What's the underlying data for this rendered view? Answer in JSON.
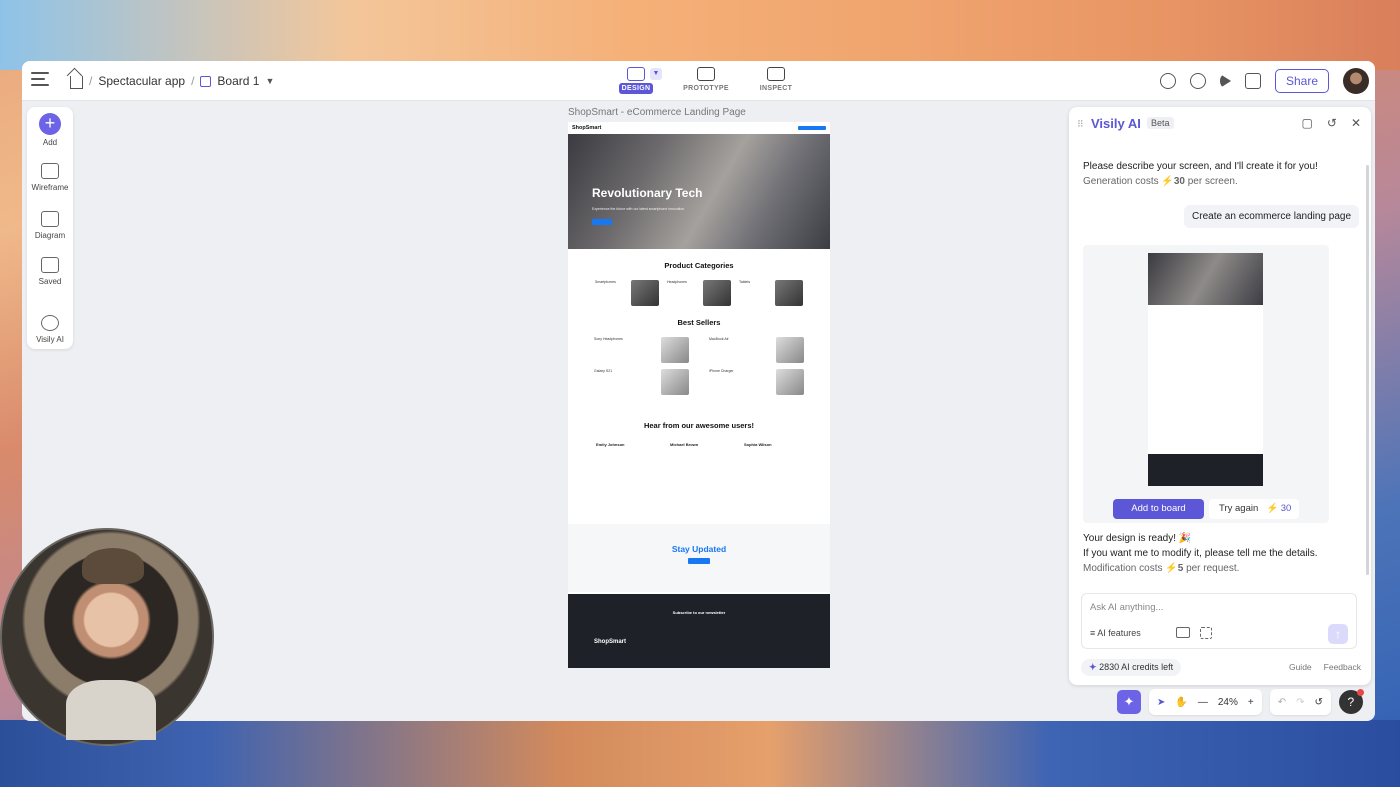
{
  "breadcrumb": {
    "project": "Spectacular app",
    "board": "Board 1"
  },
  "modes": [
    {
      "label": "DESIGN",
      "active": true
    },
    {
      "label": "PROTOTYPE",
      "active": false
    },
    {
      "label": "INSPECT",
      "active": false
    }
  ],
  "toolbar": {
    "share_label": "Share"
  },
  "left_tools": [
    "Add",
    "Wireframe",
    "Diagram",
    "Saved",
    "Visily AI"
  ],
  "canvas": {
    "board_title": "ShopSmart - eCommerce Landing Page",
    "artboard": {
      "logo": "ShopSmart",
      "hero_title": "Revolutionary Tech",
      "hero_sub": "Experience the future with our latest smartphone innovation.",
      "categories_title": "Product Categories",
      "categories": [
        "Smartphones",
        "Headphones",
        "Tablets"
      ],
      "bestsellers_title": "Best Sellers",
      "bestsellers": [
        "Sony Headphones",
        "MacBook Air",
        "Galaxy S21",
        "iPhone Charger"
      ],
      "testimonials_title": "Hear from our awesome users!",
      "testimonials": [
        "Emily Johnson",
        "Michael Brown",
        "Sophia Wilson"
      ],
      "stay_title": "Stay Updated",
      "subscribe": "Subscribe",
      "newsletter_title": "Subscribe to our newsletter",
      "footer_logo": "ShopSmart"
    }
  },
  "ai": {
    "title": "Visily AI",
    "badge": "Beta",
    "msg_line1": "Please describe your screen, and I'll create it for you!",
    "msg_cost_prefix": "Generation costs",
    "msg_cost_value": "30",
    "msg_cost_suffix": "per screen.",
    "user_prompt": "Create an ecommerce landing page",
    "add_board": "Add to board",
    "try_again": "Try again",
    "try_again_cost": "30",
    "ready": "Your design is ready! 🎉",
    "modify": "If you want me to modify it, please tell me the details.",
    "mod_cost_prefix": "Modification costs",
    "mod_cost_value": "5",
    "mod_cost_suffix": "per request.",
    "input_placeholder": "Ask AI anything...",
    "features": "AI features",
    "credits": "2830 AI credits left",
    "guide": "Guide",
    "feedback": "Feedback"
  },
  "bottom": {
    "zoom": "24%"
  }
}
